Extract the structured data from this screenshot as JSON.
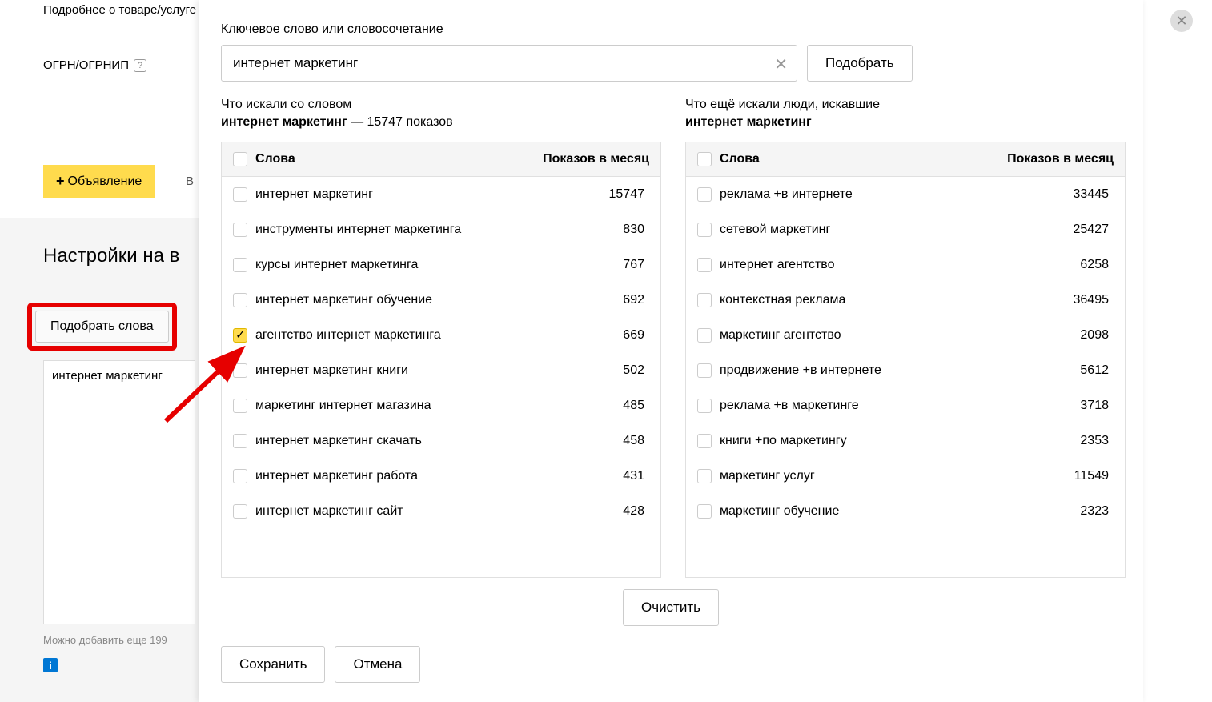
{
  "bg": {
    "product_label": "Подробнее о товаре/услуге",
    "ogrnip_label": "ОГРН/ОГРНИП",
    "add_ad_label": "Объявление",
    "letter": "В",
    "settings_title": "Настройки на в",
    "pick_words_btn": "Подобрать слова",
    "keyword_text": "интернет маркетинг",
    "footer_text": "Можно добавить еще 199"
  },
  "modal": {
    "field_label": "Ключевое слово или словосочетание",
    "search_value": "интернет маркетинг",
    "submit_label": "Подобрать",
    "left_caption_prefix": "Что искали со словом",
    "left_caption_bold": "интернет маркетинг",
    "left_caption_suffix": " — 15747 показов",
    "right_caption_prefix": "Что ещё искали люди, искавшие",
    "right_caption_bold": "интернет маркетинг",
    "header_words": "Слова",
    "header_count": "Показов в месяц",
    "clear_label": "Очистить",
    "save_label": "Сохранить",
    "cancel_label": "Отмена"
  },
  "left_rows": [
    {
      "word": "интернет маркетинг",
      "count": "15747",
      "checked": false
    },
    {
      "word": "инструменты интернет маркетинга",
      "count": "830",
      "checked": false
    },
    {
      "word": "курсы интернет маркетинга",
      "count": "767",
      "checked": false
    },
    {
      "word": "интернет маркетинг обучение",
      "count": "692",
      "checked": false
    },
    {
      "word": "агентство интернет маркетинга",
      "count": "669",
      "checked": true
    },
    {
      "word": "интернет маркетинг книги",
      "count": "502",
      "checked": false
    },
    {
      "word": "маркетинг интернет магазина",
      "count": "485",
      "checked": false
    },
    {
      "word": "интернет маркетинг скачать",
      "count": "458",
      "checked": false
    },
    {
      "word": "интернет маркетинг работа",
      "count": "431",
      "checked": false
    },
    {
      "word": "интернет маркетинг сайт",
      "count": "428",
      "checked": false
    }
  ],
  "right_rows": [
    {
      "word": "реклама +в интернете",
      "count": "33445"
    },
    {
      "word": "сетевой маркетинг",
      "count": "25427"
    },
    {
      "word": "интернет агентство",
      "count": "6258"
    },
    {
      "word": "контекстная реклама",
      "count": "36495"
    },
    {
      "word": "маркетинг агентство",
      "count": "2098"
    },
    {
      "word": "продвижение +в интернете",
      "count": "5612"
    },
    {
      "word": "реклама +в маркетинге",
      "count": "3718"
    },
    {
      "word": "книги +по маркетингу",
      "count": "2353"
    },
    {
      "word": "маркетинг услуг",
      "count": "11549"
    },
    {
      "word": "маркетинг обучение",
      "count": "2323"
    }
  ]
}
